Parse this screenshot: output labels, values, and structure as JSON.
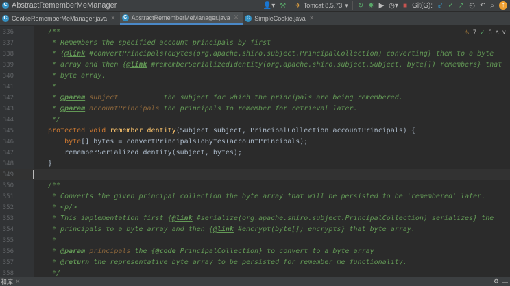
{
  "window": {
    "title": "AbstractRememberMeManager"
  },
  "toolbar": {
    "run_config": "Tomcat 8.5.73",
    "git_label": "Git(G):"
  },
  "tabs": [
    {
      "label": "CookieRememberMeManager.java"
    },
    {
      "label": "AbstractRememberMeManager.java",
      "active": true
    },
    {
      "label": "SimpleCookie.java"
    }
  ],
  "inspections": {
    "warnings": "7",
    "typos": "6"
  },
  "status": {
    "left": "和库"
  },
  "current_line": 349,
  "lines": [
    {
      "n": 336,
      "s": [
        [
          "c",
          "/**"
        ]
      ]
    },
    {
      "n": 337,
      "s": [
        [
          "c",
          " * Remembers the specified account principals by first"
        ]
      ]
    },
    {
      "n": 338,
      "s": [
        [
          "c",
          " * {"
        ],
        [
          "tag",
          "@link"
        ],
        [
          "c",
          " #convertPrincipalsToBytes("
        ],
        [
          "lk",
          "org.apache.shiro.subject.PrincipalCollection"
        ],
        [
          "c",
          ") converting} them to a byte"
        ]
      ]
    },
    {
      "n": 339,
      "s": [
        [
          "c",
          " * array and then {"
        ],
        [
          "tag",
          "@link"
        ],
        [
          "c",
          " #rememberSerializedIdentity("
        ],
        [
          "lk",
          "org.apache.shiro.subject.Subject"
        ],
        [
          "c",
          ", byte[]) remembers} that"
        ]
      ]
    },
    {
      "n": 340,
      "s": [
        [
          "c",
          " * byte array."
        ]
      ]
    },
    {
      "n": 341,
      "s": [
        [
          "c",
          " *"
        ]
      ]
    },
    {
      "n": 342,
      "s": [
        [
          "c",
          " * "
        ],
        [
          "tag",
          "@param"
        ],
        [
          "pn",
          " subject          "
        ],
        [
          "c",
          " the subject for which the principals are being remembered."
        ]
      ]
    },
    {
      "n": 343,
      "s": [
        [
          "c",
          " * "
        ],
        [
          "tag",
          "@param"
        ],
        [
          "pn",
          " accountPrincipals"
        ],
        [
          "c",
          " the principals to remember for retrieval later."
        ]
      ]
    },
    {
      "n": 344,
      "s": [
        [
          "c",
          " */"
        ]
      ]
    },
    {
      "n": 345,
      "s": [
        [
          "k",
          "protected void "
        ],
        [
          "m",
          "rememberIdentity"
        ],
        [
          "t",
          "(Subject subject, PrincipalCollection accountPrincipals) {"
        ]
      ]
    },
    {
      "n": 346,
      "s": [
        [
          "k",
          "    byte"
        ],
        [
          "t",
          "[] bytes = convertPrincipalsToBytes(accountPrincipals);"
        ]
      ]
    },
    {
      "n": 347,
      "s": [
        [
          "t",
          "    rememberSerializedIdentity(subject, bytes);"
        ]
      ]
    },
    {
      "n": 348,
      "s": [
        [
          "t",
          "}"
        ]
      ]
    },
    {
      "n": 349,
      "s": []
    },
    {
      "n": 350,
      "s": [
        [
          "c",
          "/**"
        ]
      ]
    },
    {
      "n": 351,
      "s": [
        [
          "c",
          " * Converts the given principal collection the byte array that will be persisted to be 'remembered' later."
        ]
      ]
    },
    {
      "n": 352,
      "s": [
        [
          "c",
          " * <p/>"
        ]
      ]
    },
    {
      "n": 353,
      "s": [
        [
          "c",
          " * This implementation first {"
        ],
        [
          "tag",
          "@link"
        ],
        [
          "c",
          " #serialize("
        ],
        [
          "lk",
          "org.apache.shiro.subject.PrincipalCollection"
        ],
        [
          "c",
          ") serializes} the"
        ]
      ]
    },
    {
      "n": 354,
      "s": [
        [
          "c",
          " * principals to a byte array and then {"
        ],
        [
          "tag",
          "@link"
        ],
        [
          "c",
          " #encrypt(byte[]) encrypts} that byte array."
        ]
      ]
    },
    {
      "n": 355,
      "s": [
        [
          "c",
          " *"
        ]
      ]
    },
    {
      "n": 356,
      "s": [
        [
          "c",
          " * "
        ],
        [
          "tag",
          "@param"
        ],
        [
          "pn",
          " principals"
        ],
        [
          "c",
          " the {"
        ],
        [
          "tag",
          "@code"
        ],
        [
          "c",
          " PrincipalCollection} to convert to a byte array"
        ]
      ]
    },
    {
      "n": 357,
      "s": [
        [
          "c",
          " * "
        ],
        [
          "tag",
          "@return"
        ],
        [
          "c",
          " the representative byte array to be persisted for remember me functionality."
        ]
      ]
    },
    {
      "n": 358,
      "s": [
        [
          "c",
          " */"
        ]
      ]
    }
  ]
}
